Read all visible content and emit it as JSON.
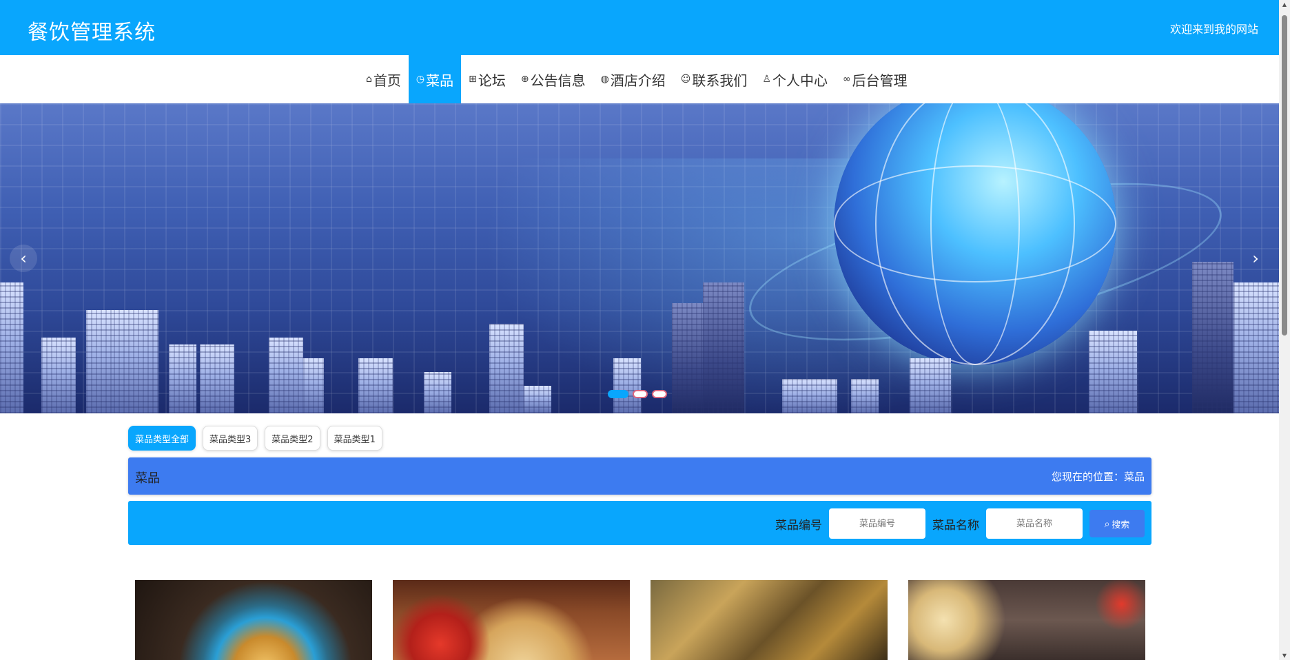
{
  "header": {
    "site_title": "餐饮管理系统",
    "welcome_text": "欢迎来到我的网站"
  },
  "nav": {
    "items": [
      {
        "label": "首页",
        "icon": "home-icon"
      },
      {
        "label": "菜品",
        "icon": "clock-icon",
        "active": true
      },
      {
        "label": "论坛",
        "icon": "grid-icon"
      },
      {
        "label": "公告信息",
        "icon": "gift-icon"
      },
      {
        "label": "酒店介绍",
        "icon": "globe-icon"
      },
      {
        "label": "联系我们",
        "icon": "face-icon"
      },
      {
        "label": "个人中心",
        "icon": "user-icon"
      },
      {
        "label": "后台管理",
        "icon": "link-icon"
      }
    ]
  },
  "carousel": {
    "prev_label": "‹",
    "next_label": "›",
    "slide_count": 3,
    "active_index": 0
  },
  "type_tabs": [
    {
      "label": "菜品类型全部",
      "active": true
    },
    {
      "label": "菜品类型3"
    },
    {
      "label": "菜品类型2"
    },
    {
      "label": "菜品类型1"
    }
  ],
  "location": {
    "title": "菜品",
    "path": "您现在的位置：菜品"
  },
  "search": {
    "field1_label": "菜品编号",
    "field1_placeholder": "菜品编号",
    "field2_label": "菜品名称",
    "field2_placeholder": "菜品名称",
    "button_label": "搜索"
  },
  "colors": {
    "primary": "#09a6fd",
    "accent": "#3d7bf0"
  }
}
